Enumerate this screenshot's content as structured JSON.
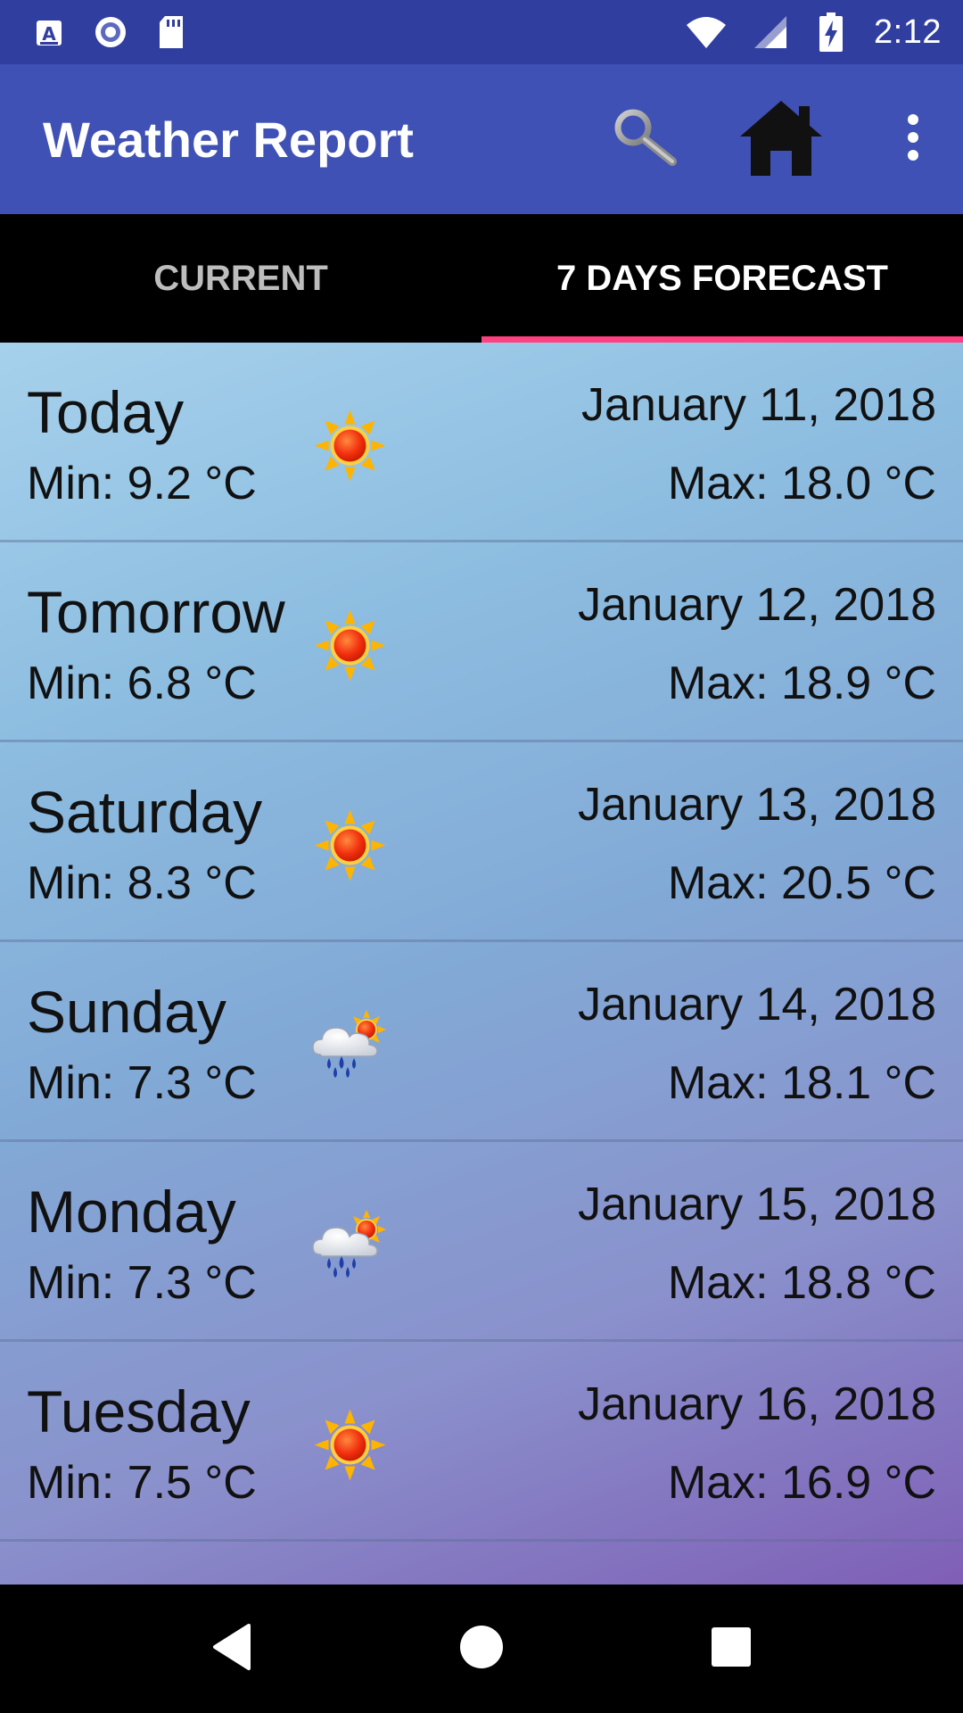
{
  "status_bar": {
    "time": "2:12",
    "icons": [
      "a-store-icon",
      "record-icon",
      "sd-card-icon",
      "wifi-icon",
      "cell-signal-icon",
      "battery-charging-icon"
    ]
  },
  "app_bar": {
    "title": "Weather Report",
    "actions": [
      "search-icon",
      "home-icon",
      "overflow-menu-icon"
    ]
  },
  "tabs": [
    {
      "label": "CURRENT",
      "active": false
    },
    {
      "label": "7 DAYS FORECAST",
      "active": true
    }
  ],
  "forecast": [
    {
      "day": "Today",
      "min": "Min: 9.2 °C",
      "date": "January 11, 2018",
      "max": "Max: 18.0 °C",
      "icon": "sun-icon"
    },
    {
      "day": "Tomorrow",
      "min": "Min: 6.8 °C",
      "date": "January 12, 2018",
      "max": "Max: 18.9 °C",
      "icon": "sun-icon"
    },
    {
      "day": "Saturday",
      "min": "Min: 8.3 °C",
      "date": "January 13, 2018",
      "max": "Max: 20.5 °C",
      "icon": "sun-icon"
    },
    {
      "day": "Sunday",
      "min": "Min: 7.3 °C",
      "date": "January 14, 2018",
      "max": "Max: 18.1 °C",
      "icon": "rain-cloud-sun-icon"
    },
    {
      "day": "Monday",
      "min": "Min: 7.3 °C",
      "date": "January 15, 2018",
      "max": "Max: 18.8 °C",
      "icon": "rain-cloud-sun-icon"
    },
    {
      "day": "Tuesday",
      "min": "Min: 7.5 °C",
      "date": "January 16, 2018",
      "max": "Max: 16.9 °C",
      "icon": "sun-icon"
    }
  ],
  "nav_bar": {
    "buttons": [
      "back-icon",
      "home-circle-icon",
      "recents-icon"
    ]
  },
  "colors": {
    "status_bar": "#303f9f",
    "app_bar": "#3f51b5",
    "tab_indicator": "#ff4081"
  }
}
